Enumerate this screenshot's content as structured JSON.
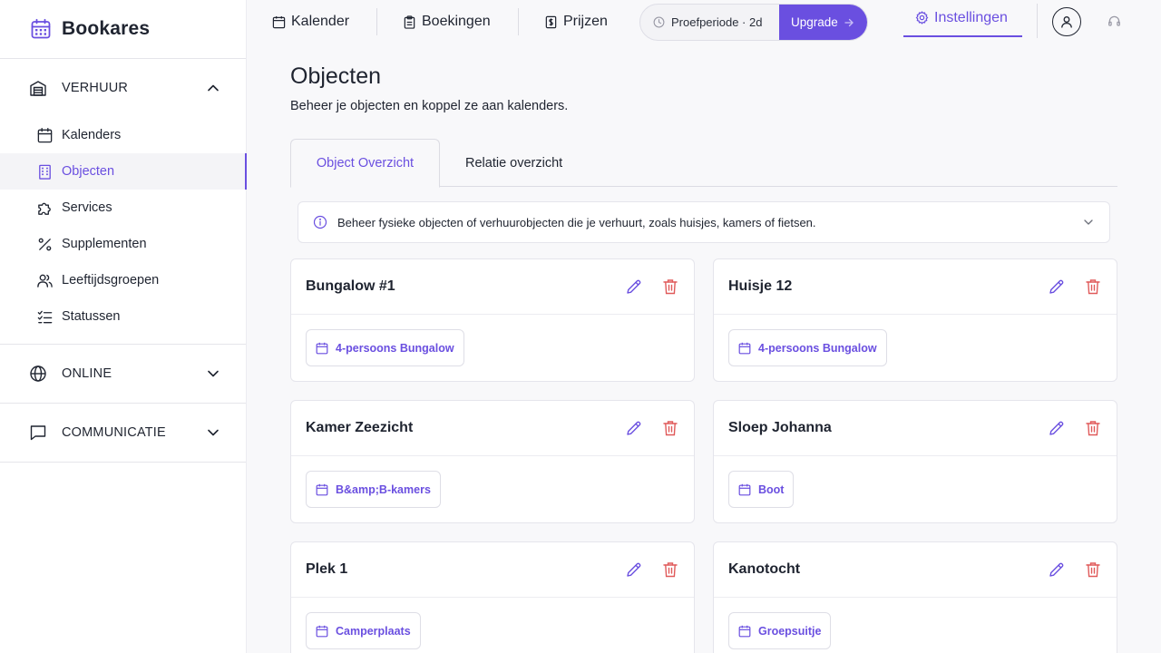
{
  "brand": {
    "name": "Bookares"
  },
  "sidebar": {
    "sections": [
      {
        "label": "VERHUUR",
        "expanded": true
      },
      {
        "label": "ONLINE",
        "expanded": false
      },
      {
        "label": "COMMUNICATIE",
        "expanded": false
      }
    ],
    "items": [
      {
        "label": "Kalenders",
        "icon": "calendar-icon"
      },
      {
        "label": "Objecten",
        "icon": "building-icon",
        "active": true
      },
      {
        "label": "Services",
        "icon": "puzzle-icon"
      },
      {
        "label": "Supplementen",
        "icon": "percent-icon"
      },
      {
        "label": "Leeftijdsgroepen",
        "icon": "users-icon"
      },
      {
        "label": "Statussen",
        "icon": "checklist-icon"
      }
    ]
  },
  "topnav": {
    "links": [
      {
        "label": "Kalender",
        "icon": "calendar-icon"
      },
      {
        "label": "Boekingen",
        "icon": "clipboard-icon"
      },
      {
        "label": "Prijzen",
        "icon": "price-icon"
      }
    ],
    "trial_label": "Proefperiode · 2d",
    "upgrade_label": "Upgrade",
    "settings_label": "Instellingen"
  },
  "page": {
    "title": "Objecten",
    "subtitle": "Beheer je objecten en koppel ze aan kalenders."
  },
  "tabs": [
    {
      "label": "Object Overzicht",
      "active": true
    },
    {
      "label": "Relatie overzicht",
      "active": false
    }
  ],
  "info": {
    "text": "Beheer fysieke objecten of verhuurobjecten die je verhuurt, zoals huisjes, kamers of fietsen."
  },
  "objects": [
    {
      "name": "Bungalow #1",
      "calendar": "4-persoons Bungalow"
    },
    {
      "name": "Huisje 12",
      "calendar": "4-persoons Bungalow"
    },
    {
      "name": "Kamer Zeezicht",
      "calendar": "B&amp;B-kamers"
    },
    {
      "name": "Sloep Johanna",
      "calendar": "Boot"
    },
    {
      "name": "Plek 1",
      "calendar": "Camperplaats"
    },
    {
      "name": "Kanotocht",
      "calendar": "Groepsuitje"
    }
  ],
  "colors": {
    "accent": "#6a4fe0",
    "danger": "#e05a5a",
    "text": "#1f2430"
  }
}
